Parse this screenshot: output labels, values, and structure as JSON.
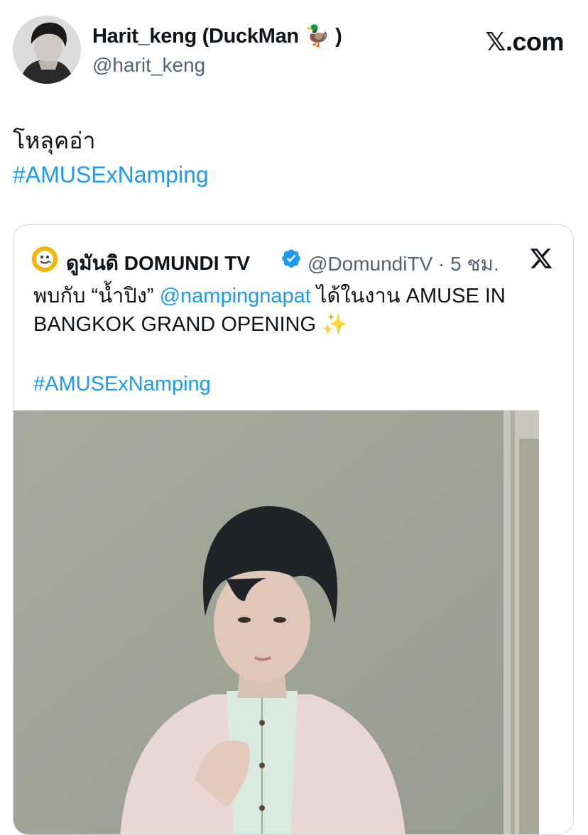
{
  "tweet": {
    "author_name": "Harit_keng (DuckMan 🦆 )",
    "author_handle": "@harit_keng",
    "site_label": ".com",
    "text_lines": [
      "โหลุคอ่า"
    ],
    "hashtag": "#AMUSExNamping"
  },
  "quoted": {
    "author_name": "ดูมันดิ DOMUNDI TV",
    "author_handle": "@DomundiTV · 5 ชม.",
    "text_line1_prefix": "พบกับ “น้ำปิง” ",
    "mention": "@nampingnapat",
    "text_line1_suffix": " ได้ในงาน AMUSE IN",
    "text_line2": "BANGKOK GRAND OPENING ",
    "sparkle": "✨",
    "hashtag": "#AMUSExNamping"
  },
  "icons": {
    "site_logo": "x-logo-icon",
    "verified": "verified-badge-icon",
    "quote_source": "x-logo-icon"
  },
  "colors": {
    "link": "#1d9bf0",
    "secondary_text": "#536471",
    "verified": "#1d9bf0",
    "card_border": "#cfd9de"
  }
}
